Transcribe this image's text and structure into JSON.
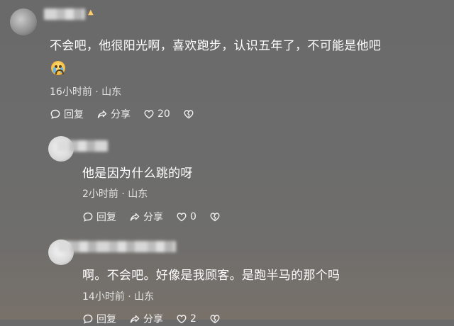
{
  "comments": [
    {
      "text": "不会吧，他很阳光啊，喜欢跑步，认识五年了，不可能是他吧",
      "emoji": "crying-face",
      "time": "16小时前 · 山东",
      "reply_label": "回复",
      "share_label": "分享",
      "like_count": "20"
    },
    {
      "text": "他是因为什么跳的呀",
      "time": "2小时前 · 山东",
      "reply_label": "回复",
      "share_label": "分享",
      "like_count": "0"
    },
    {
      "text": "啊。不会吧。好像是我顾客。是跑半马的那个吗",
      "time": "14小时前 · 山东",
      "reply_label": "回复",
      "share_label": "分享",
      "like_count": "2"
    }
  ],
  "colors": {
    "background": "#6b6b6b",
    "text": "#ffffff",
    "meta": "#e4e4e4"
  }
}
